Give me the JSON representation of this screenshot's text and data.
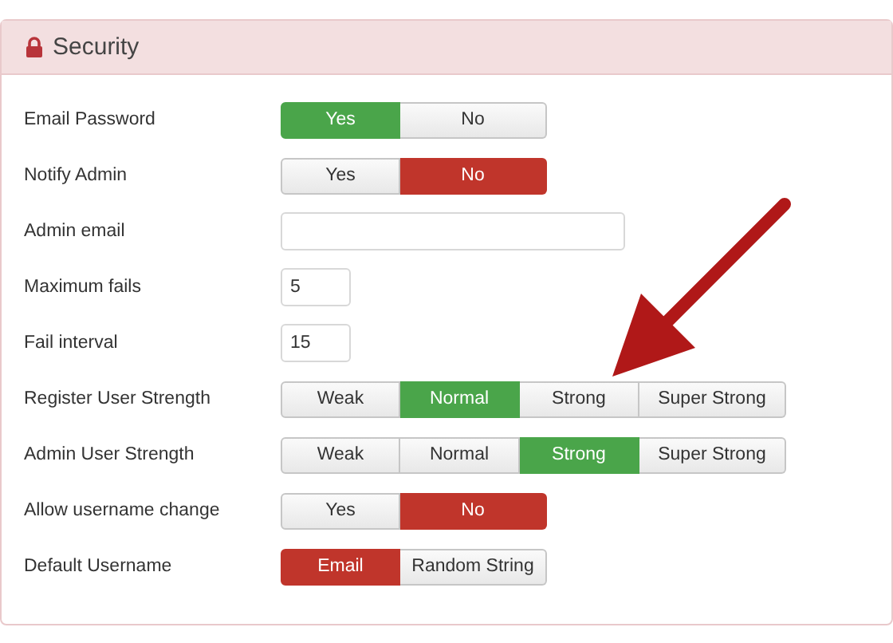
{
  "panel": {
    "title": "Security"
  },
  "fields": [
    {
      "label": "Email Password",
      "kind": "toggle",
      "color": "#4aa54a",
      "options": [
        {
          "label": "Yes",
          "selected": true
        },
        {
          "label": "No",
          "selected": false
        }
      ]
    },
    {
      "label": "Notify Admin",
      "kind": "toggle",
      "color": "#c0352b",
      "options": [
        {
          "label": "Yes",
          "selected": false
        },
        {
          "label": "No",
          "selected": true
        }
      ]
    },
    {
      "label": "Admin email",
      "kind": "email"
    },
    {
      "label": "Maximum fails",
      "kind": "number",
      "value": "5"
    },
    {
      "label": "Fail interval",
      "kind": "number",
      "value": "15"
    },
    {
      "label": "Register User Strength",
      "kind": "toggle",
      "color": "#4aa54a",
      "options": [
        {
          "label": "Weak",
          "selected": false
        },
        {
          "label": "Normal",
          "selected": true
        },
        {
          "label": "Strong",
          "selected": false
        },
        {
          "label": "Super Strong",
          "selected": false
        }
      ]
    },
    {
      "label": "Admin User Strength",
      "kind": "toggle",
      "color": "#4aa54a",
      "options": [
        {
          "label": "Weak",
          "selected": false
        },
        {
          "label": "Normal",
          "selected": false
        },
        {
          "label": "Strong",
          "selected": true
        },
        {
          "label": "Super Strong",
          "selected": false
        }
      ]
    },
    {
      "label": "Allow username change",
      "kind": "toggle",
      "color": "#c0352b",
      "options": [
        {
          "label": "Yes",
          "selected": false
        },
        {
          "label": "No",
          "selected": true
        }
      ]
    },
    {
      "label": "Default Username",
      "kind": "toggle",
      "color": "#c0352b",
      "options": [
        {
          "label": "Email",
          "selected": true
        },
        {
          "label": "Random String",
          "selected": false
        }
      ]
    }
  ]
}
